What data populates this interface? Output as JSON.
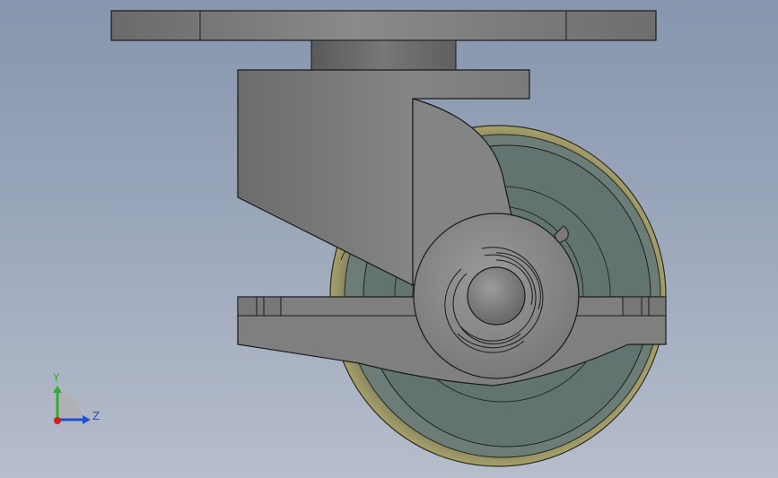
{
  "triad": {
    "y_label": "Y",
    "z_label": "Z",
    "y_color": "#2fae2f",
    "z_color": "#2050d0",
    "x_color": "#d02020"
  },
  "colors": {
    "background_top": "#8796ae",
    "background_bottom": "#b6bdcb",
    "metal": "#7d7d7d",
    "metal_dark": "#5f5f5f",
    "wheel_tread": "#8e8c62",
    "wheel_core": "#627470",
    "outline": "#1a1a1a"
  }
}
